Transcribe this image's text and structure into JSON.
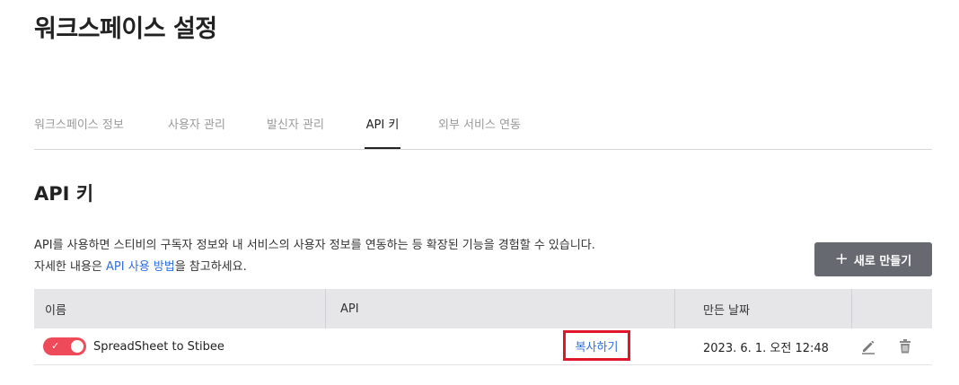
{
  "page": {
    "title": "워크스페이스 설정"
  },
  "tabs": [
    {
      "label": "워크스페이스 정보",
      "active": false
    },
    {
      "label": "사용자 관리",
      "active": false
    },
    {
      "label": "발신자 관리",
      "active": false
    },
    {
      "label": "API 키",
      "active": true
    },
    {
      "label": "외부 서비스 연동",
      "active": false
    }
  ],
  "section": {
    "title": "API 키",
    "desc_line1": "API를 사용하면 스티비의 구독자 정보와 내 서비스의 사용자 정보를 연동하는 등 확장된 기능을 경험할 수 있습니다.",
    "desc_line2_pre": "자세한 내용은 ",
    "desc_link": "API 사용 방법",
    "desc_line2_post": "을 참고하세요."
  },
  "new_button": {
    "icon": "plus-icon",
    "label": "새로 만들기"
  },
  "table": {
    "headers": {
      "name": "이름",
      "api": "API",
      "created": "만든 날짜"
    },
    "rows": [
      {
        "enabled": true,
        "name": "SpreadSheet to Stibee",
        "copy_label": "복사하기",
        "created": "2023. 6. 1. 오전 12:48",
        "edit_icon": "pencil-icon",
        "delete_icon": "trash-icon"
      }
    ]
  },
  "colors": {
    "toggle_on": "#ef4a5a",
    "link": "#2f6fe0",
    "highlight_border": "#e0162b",
    "button_bg": "#666a70",
    "header_bg": "#e6e6e9"
  }
}
